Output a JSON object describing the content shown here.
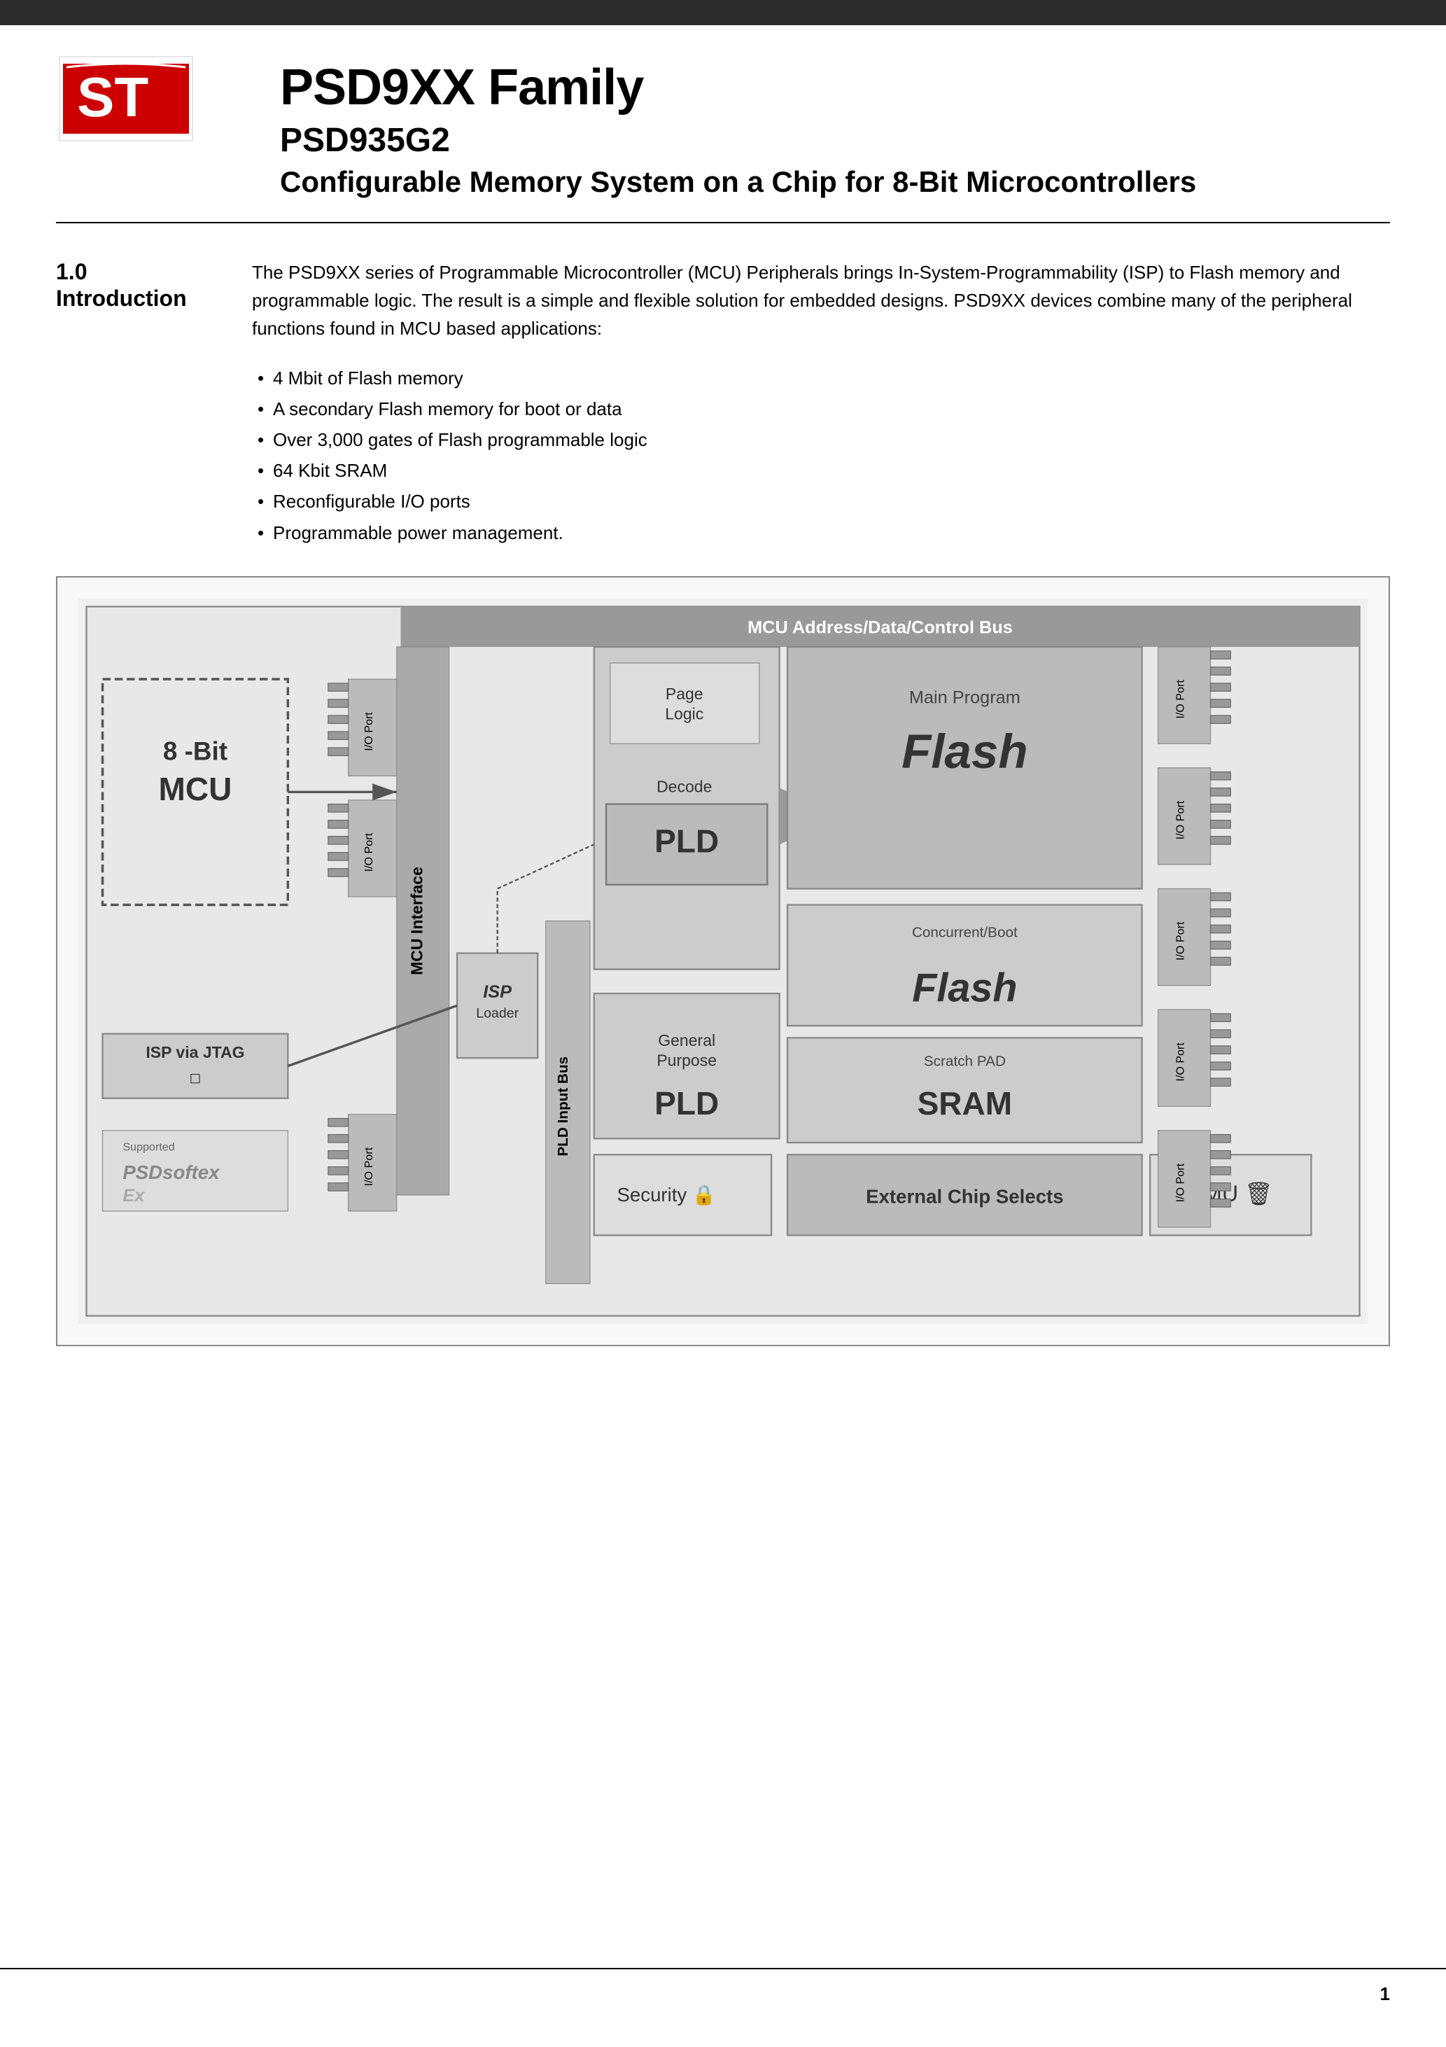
{
  "header": {
    "bar_color": "#2c2c2c",
    "main_title": "PSD9XX Family",
    "sub_title": "PSD935G2",
    "desc_title": "Configurable Memory System on a Chip for 8-Bit Microcontrollers"
  },
  "section": {
    "number": "1.0",
    "name": "Introduction",
    "intro_paragraph": "The PSD9XX series of Programmable Microcontroller (MCU) Peripherals brings In-System-Programmability (ISP) to Flash memory and programmable logic. The result is a simple and flexible solution for embedded designs. PSD9XX devices combine many of the peripheral functions found in MCU based applications:",
    "bullets": [
      "4 Mbit of Flash memory",
      "A secondary Flash memory for boot or data",
      "Over 3,000 gates of Flash programmable logic",
      "64 Kbit SRAM",
      "Reconfigurable I/O ports",
      "Programmable power management."
    ]
  },
  "diagram": {
    "bus_label": "MCU Address/Data/Control Bus",
    "mcu_label": "8 -Bit\nMCU",
    "mcu_interface_label": "MCU Interface",
    "isp_jtag_label": "ISP via JTAG",
    "isp_loader_label": "ISP\nLoader",
    "page_logic_label": "Page\nLogic",
    "decode_label": "Decode",
    "pld_main_label": "PLD",
    "main_program_label": "Main Program",
    "flash_main_label": "Flash",
    "concurrent_boot_label": "Concurrent/Boot",
    "flash_boot_label": "Flash",
    "scratch_pad_label": "Scratch PAD",
    "sram_label": "SRAM",
    "general_purpose_label": "General\nPurpose",
    "pld_input_bus_label": "PLD Input Bus",
    "pld_gp_label": "PLD",
    "external_cs_label": "External Chip Selects",
    "security_label": "Security",
    "pmu_label": "PMU",
    "io_port_labels": [
      "I/O Port",
      "I/O Port",
      "I/O Port",
      "I/O Port",
      "I/O Port",
      "I/O Port",
      "I/O Port",
      "I/O Port"
    ]
  },
  "footer": {
    "page_number": "1"
  }
}
